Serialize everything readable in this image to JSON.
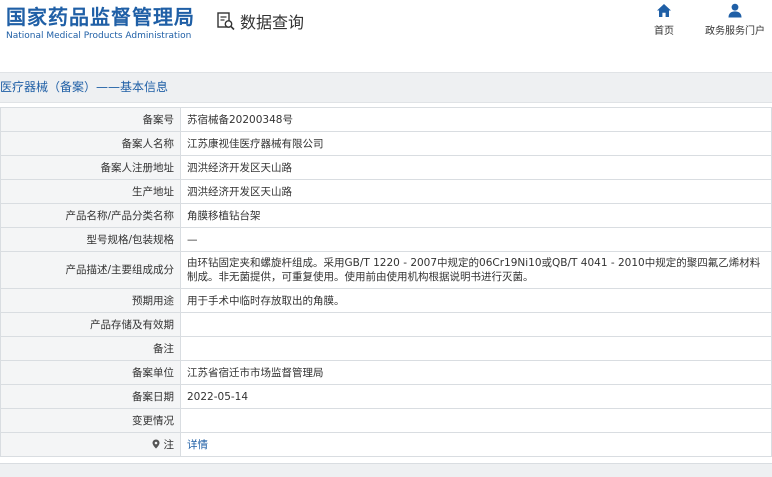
{
  "header": {
    "logo_cn": "国家药品监督管理局",
    "logo_en": "National Medical Products Administration",
    "page_heading": "数据查询",
    "nav_home": "首页",
    "nav_service": "政务服务门户"
  },
  "section_title": "医疗器械（备案）——基本信息",
  "rows": [
    {
      "label": "备案号",
      "value": "苏宿械备20200348号"
    },
    {
      "label": "备案人名称",
      "value": "江苏康视佳医疗器械有限公司"
    },
    {
      "label": "备案人注册地址",
      "value": "泗洪经济开发区天山路"
    },
    {
      "label": "生产地址",
      "value": "泗洪经济开发区天山路"
    },
    {
      "label": "产品名称/产品分类名称",
      "value": "角膜移植钻台架"
    },
    {
      "label": "型号规格/包装规格",
      "value": "—"
    },
    {
      "label": "产品描述/主要组成成分",
      "value": "由环钻固定夹和螺旋杆组成。采用GB/T 1220 - 2007中规定的06Cr19Ni10或QB/T 4041 - 2010中规定的聚四氟乙烯材料制成。非无菌提供，可重复使用。使用前由使用机构根据说明书进行灭菌。"
    },
    {
      "label": "预期用途",
      "value": "用于手术中临时存放取出的角膜。"
    },
    {
      "label": "产品存储及有效期",
      "value": ""
    },
    {
      "label": "备注",
      "value": ""
    },
    {
      "label": "备案单位",
      "value": "江苏省宿迁市市场监督管理局"
    },
    {
      "label": "备案日期",
      "value": "2022-05-14"
    },
    {
      "label": "变更情况",
      "value": ""
    },
    {
      "label": "注",
      "value": "详情"
    }
  ]
}
